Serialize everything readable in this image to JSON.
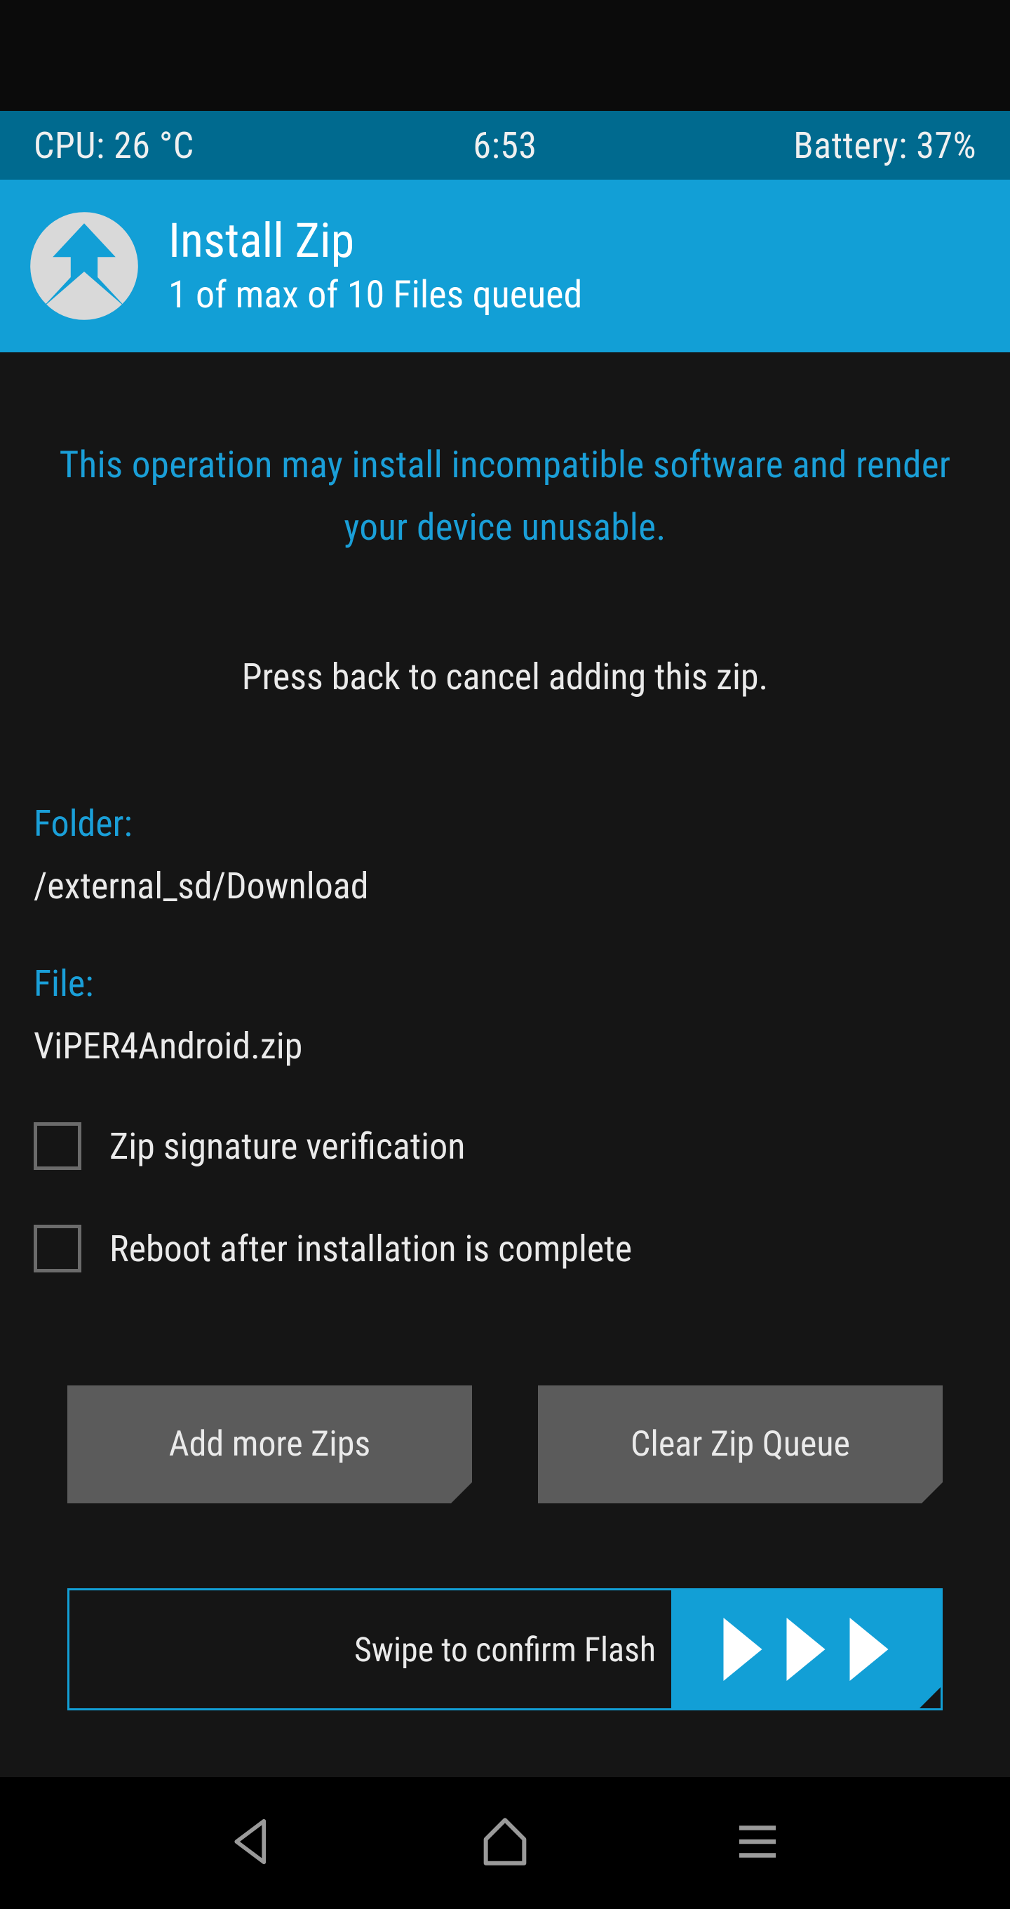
{
  "status": {
    "cpu": "CPU: 26 °C",
    "time": "6:53",
    "battery": "Battery: 37%"
  },
  "header": {
    "title": "Install Zip",
    "subtitle": "1 of max of 10 Files queued"
  },
  "warning": "This operation may install incompatible software and render your device unusable.",
  "instruction": "Press back to cancel adding this zip.",
  "folder": {
    "label": "Folder:",
    "value": "/external_sd/Download"
  },
  "file": {
    "label": "File:",
    "value": "ViPER4Android.zip"
  },
  "checkboxes": {
    "sig": "Zip signature verification",
    "reboot": "Reboot after installation is complete"
  },
  "buttons": {
    "add": "Add more Zips",
    "clear": "Clear Zip Queue"
  },
  "swipe": {
    "label": "Swipe to confirm Flash"
  }
}
